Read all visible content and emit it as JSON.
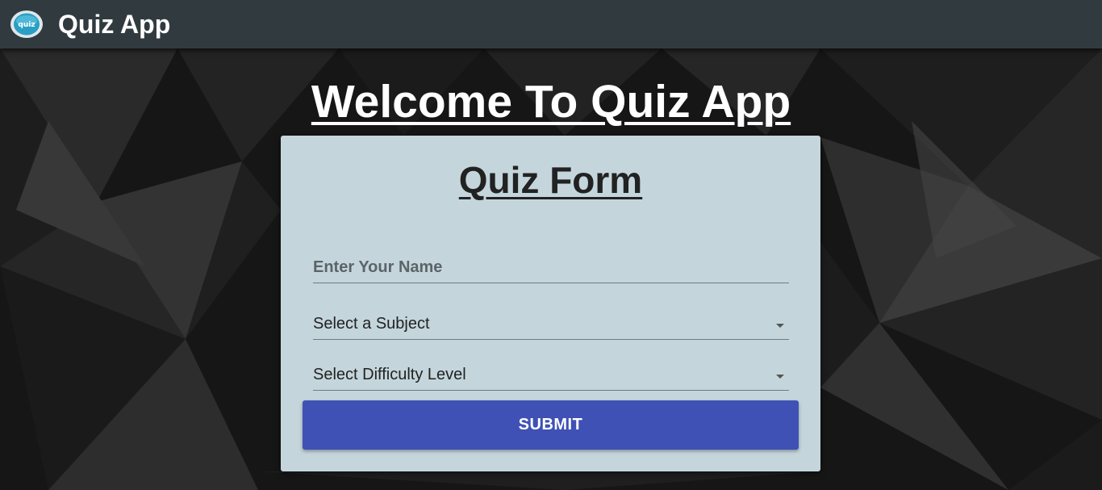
{
  "appbar": {
    "title": "Quiz App",
    "logo_icon": "quiz-logo-icon",
    "logo_text": "quiz"
  },
  "main": {
    "welcome_heading": "Welcome To Quiz App"
  },
  "form": {
    "title": "Quiz Form",
    "name_field": {
      "placeholder": "Enter Your Name",
      "value": ""
    },
    "subject_select": {
      "selected": "Select a Subject",
      "icon": "dropdown-arrow-icon"
    },
    "difficulty_select": {
      "selected": "Select Difficulty Level",
      "icon": "dropdown-arrow-icon"
    },
    "submit_label": "SUBMIT"
  },
  "colors": {
    "appbar": "#313b3f",
    "card": "#c4d6dc",
    "primary_button": "#3f51b5",
    "background": "#151515"
  }
}
